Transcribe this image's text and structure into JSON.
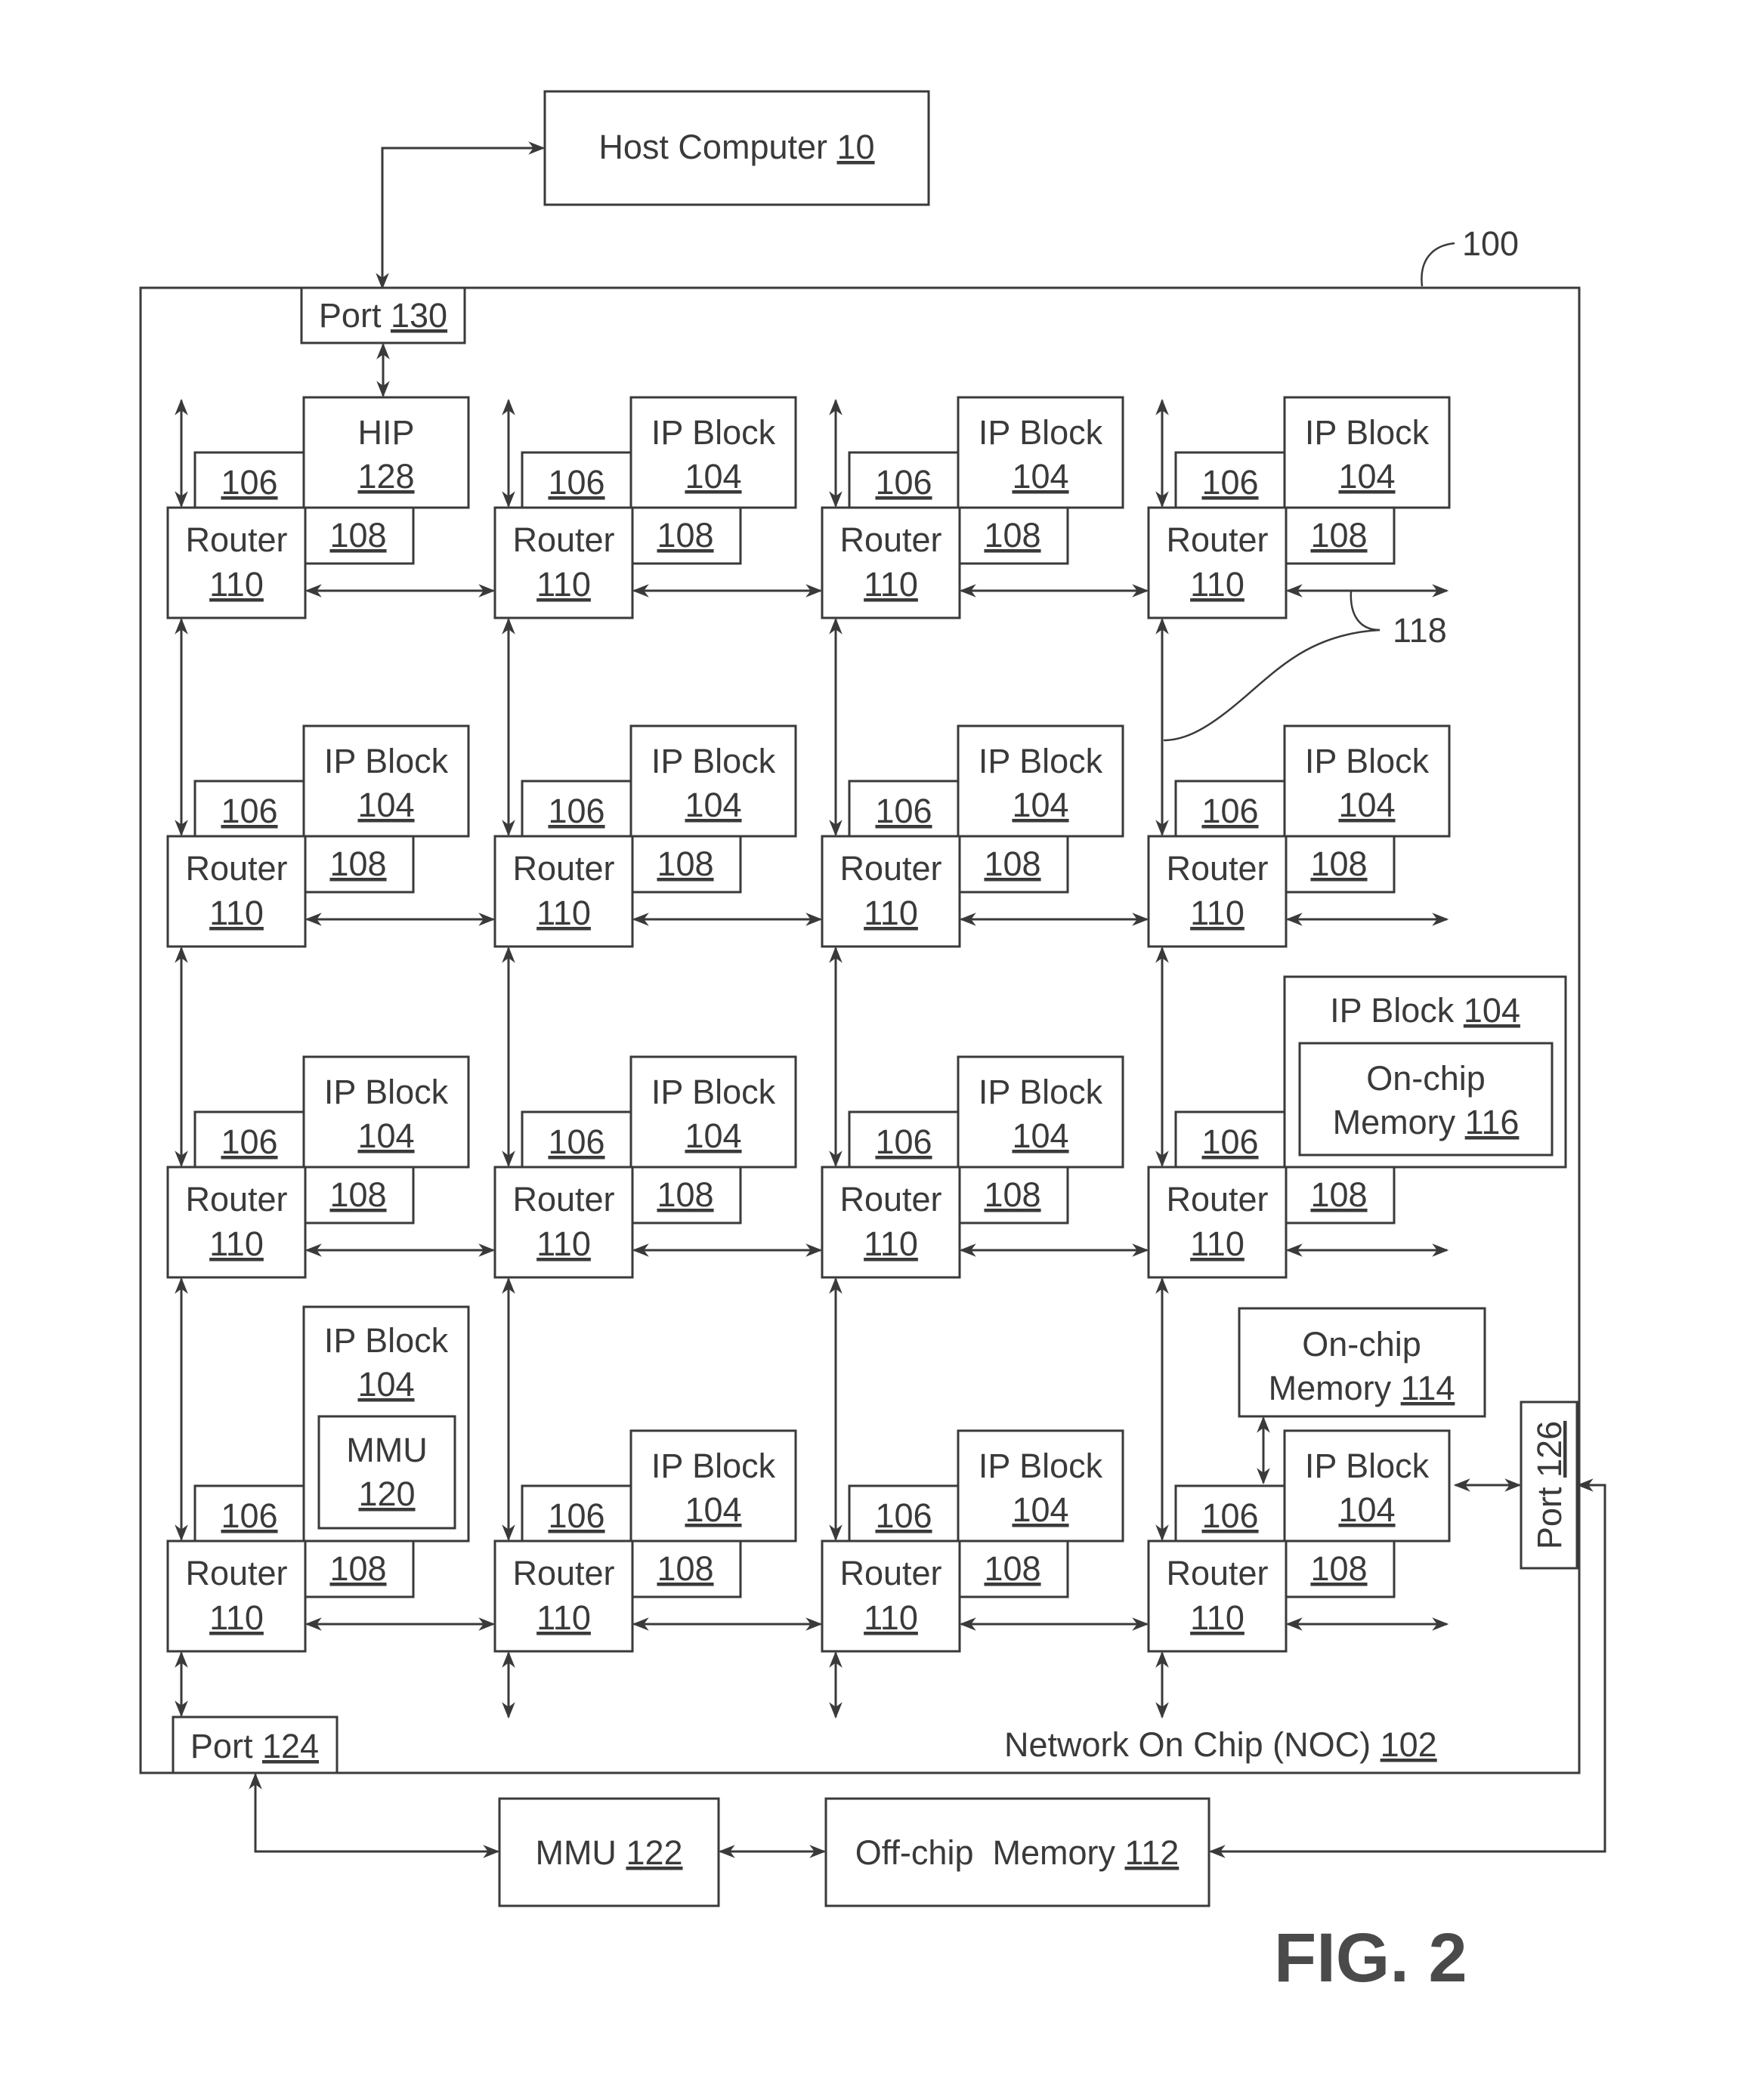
{
  "figure": {
    "title": "FIG. 2",
    "system_ref": "100",
    "link_ref": "118"
  },
  "host": {
    "text": "Host Computer",
    "ref": "10"
  },
  "noc": {
    "text": "Network On Chip (NOC)",
    "ref": "102"
  },
  "ports": {
    "host_port": {
      "text": "Port",
      "ref": "130"
    },
    "memory_port": {
      "text": "Port",
      "ref": "124"
    },
    "side_port": {
      "text": "Port",
      "ref": "126"
    }
  },
  "external": {
    "mmu": {
      "text": "MMU",
      "ref": "122"
    },
    "offchip_memory": {
      "text": "Off-chip  Memory",
      "ref": "112"
    }
  },
  "cell_labels": {
    "router": {
      "text": "Router",
      "ref": "110"
    },
    "memory_comm_controller": {
      "ref": "106"
    },
    "network_interface_controller": {
      "ref": "108"
    },
    "ip_block": {
      "text": "IP Block",
      "ref": "104"
    }
  },
  "special_blocks": {
    "hip": {
      "text": "HIP",
      "ref": "128"
    },
    "ip_with_memory": {
      "text": "IP Block",
      "ref": "104",
      "inner_line1": "On-chip",
      "inner_line2": "Memory",
      "inner_ref": "116"
    },
    "ip_with_mmu": {
      "text": "IP Block",
      "ref": "104",
      "inner_line1": "MMU",
      "inner_ref": "120"
    },
    "onchip_memory": {
      "line1": "On-chip",
      "line2": "Memory",
      "ref": "114"
    }
  },
  "grid": {
    "rows": 4,
    "cols": 4,
    "cells": [
      [
        "hip",
        "ip",
        "ip",
        "ip"
      ],
      [
        "ip",
        "ip",
        "ip",
        "ip"
      ],
      [
        "ip",
        "ip",
        "ip",
        "ip_with_memory"
      ],
      [
        "ip_with_mmu",
        "ip",
        "ip",
        "ip"
      ]
    ]
  },
  "colors": {
    "ink": "#3a3a3a",
    "background": "#ffffff"
  }
}
